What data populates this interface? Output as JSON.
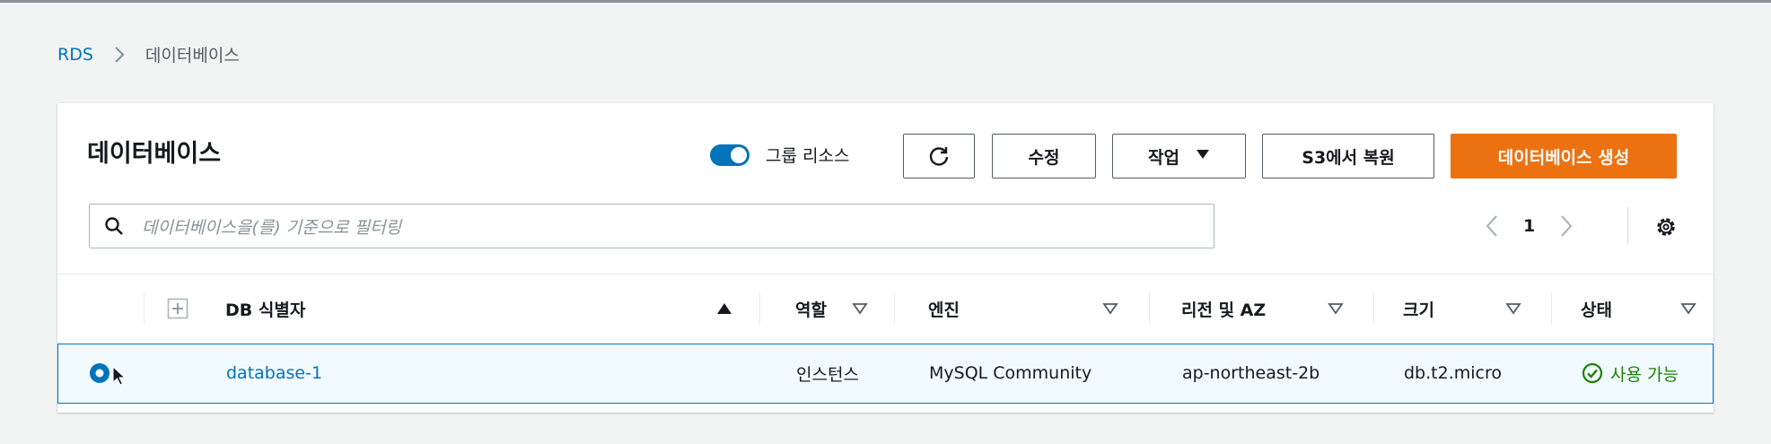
{
  "breadcrumb": {
    "root": "RDS",
    "current": "데이터베이스"
  },
  "panel": {
    "title": "데이터베이스",
    "group_toggle": {
      "label": "그룹 리소스",
      "on": true
    },
    "buttons": {
      "refresh_icon": "refresh-icon",
      "edit": "수정",
      "actions": "작업",
      "restore_s3": "S3에서 복원",
      "create": "데이터베이스 생성"
    },
    "search": {
      "placeholder": "데이터베이스을(를) 기준으로 필터링"
    },
    "pagination": {
      "page": "1"
    }
  },
  "table": {
    "columns": [
      "DB 식별자",
      "역할",
      "엔진",
      "리전 및 AZ",
      "크기",
      "상태"
    ],
    "rows": [
      {
        "identifier": "database-1",
        "role": "인스턴스",
        "engine": "MySQL Community",
        "region_az": "ap-northeast-2b",
        "size": "db.t2.micro",
        "status": "사용 가능",
        "selected": true
      }
    ]
  },
  "colors": {
    "accent": "#0073bb",
    "primary_button": "#ec7211",
    "status_ok": "#1d8102"
  }
}
